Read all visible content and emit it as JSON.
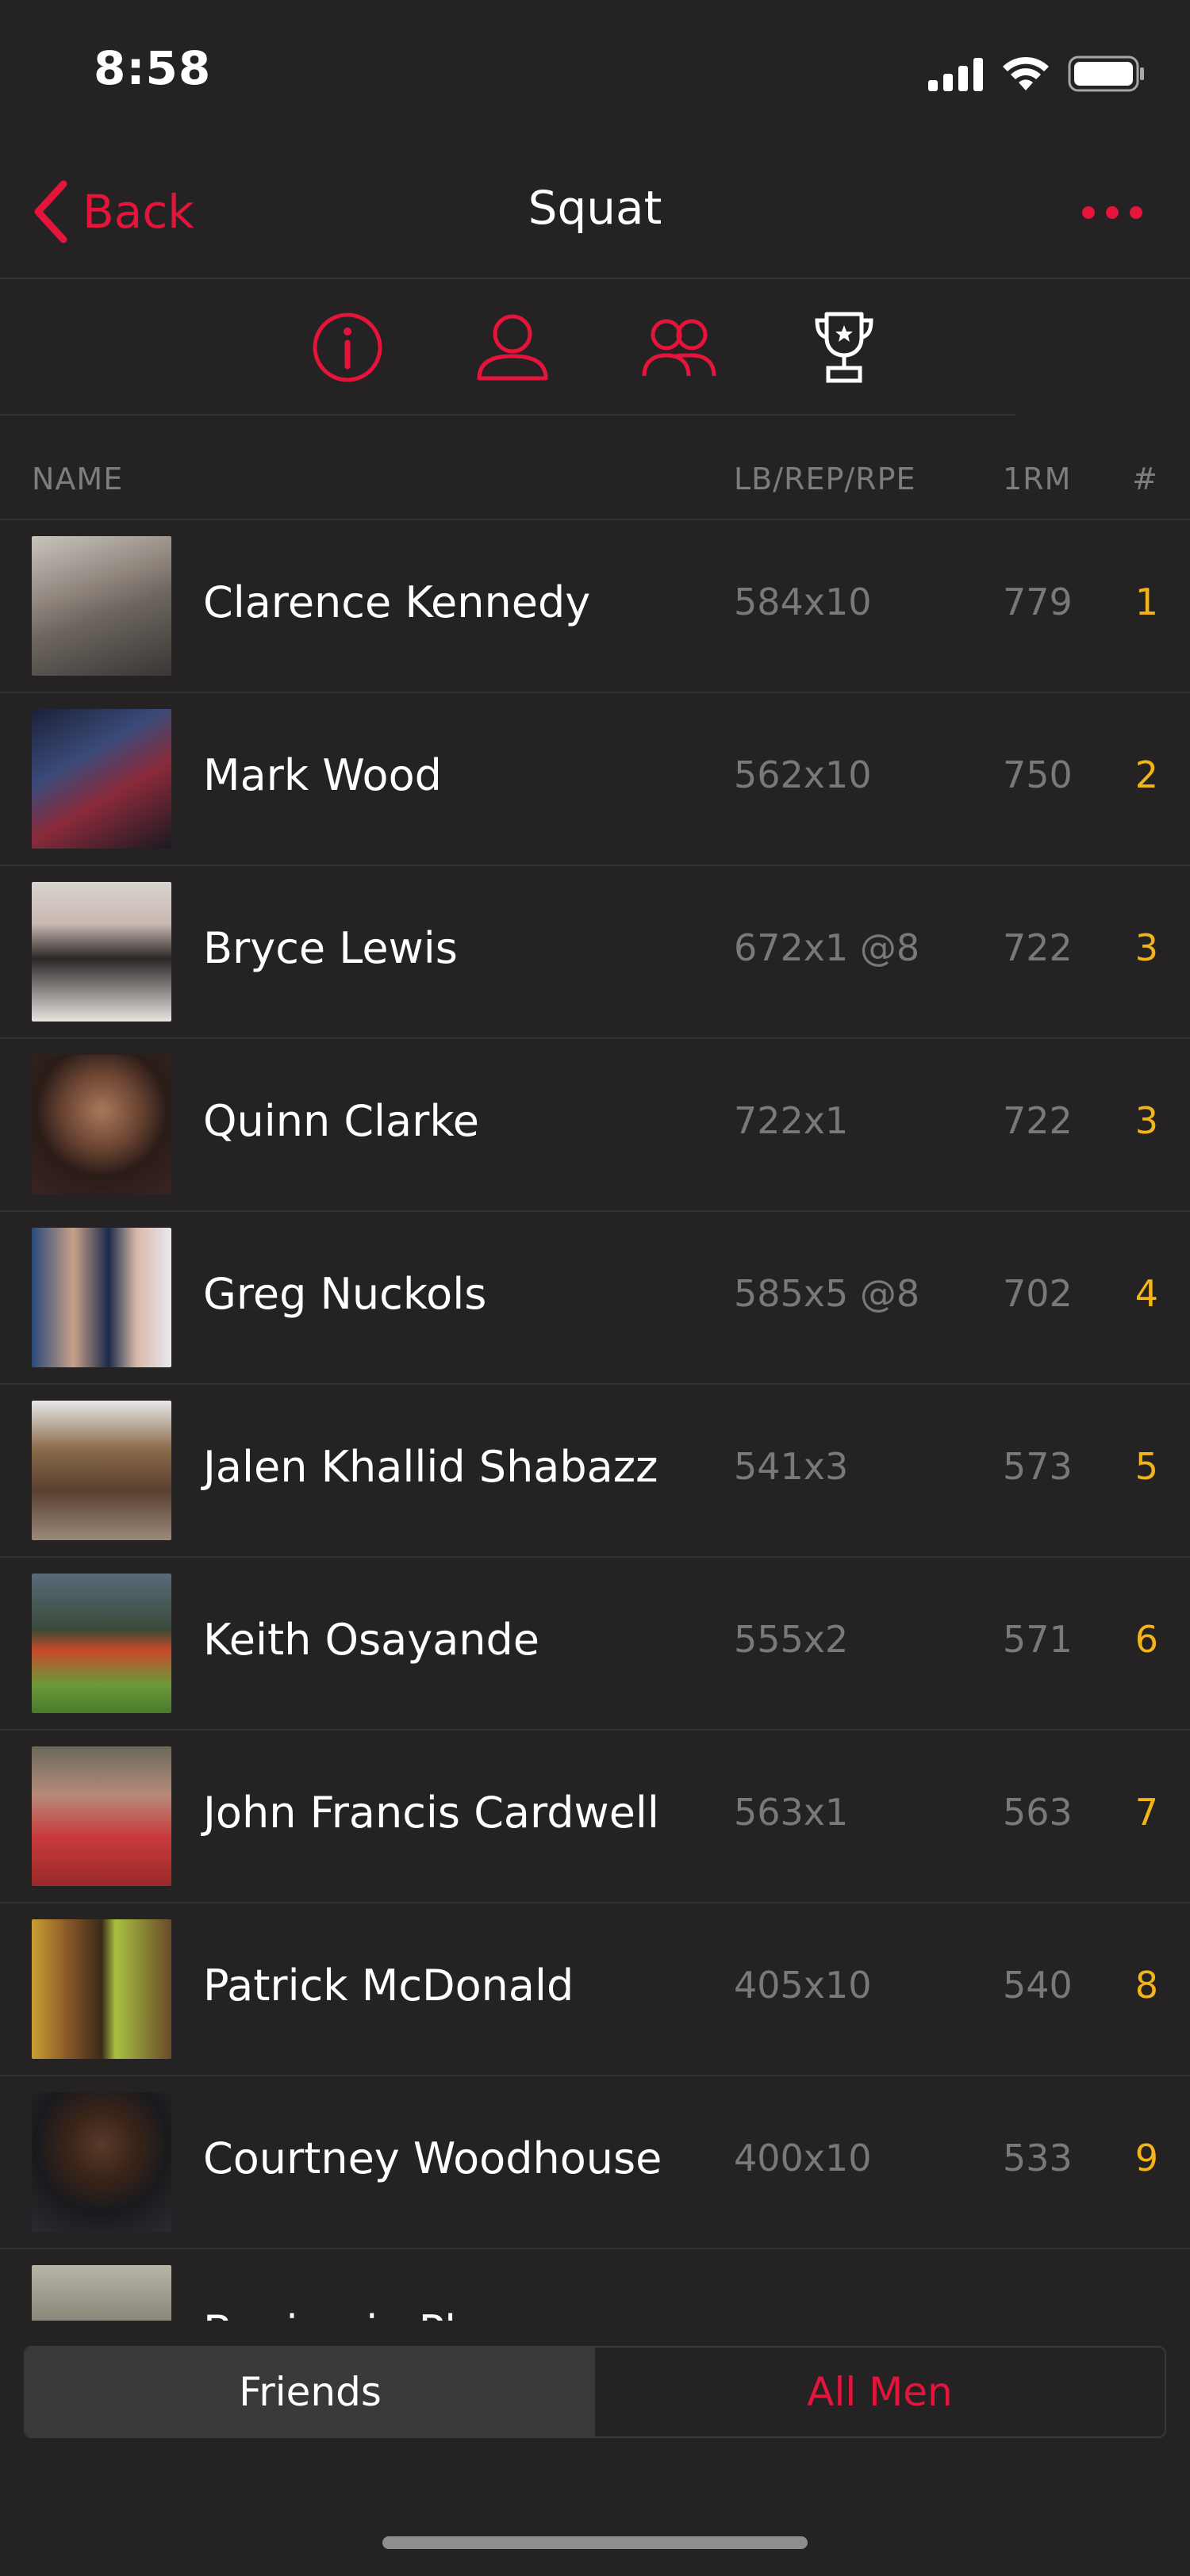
{
  "status_bar": {
    "time": "8:58"
  },
  "nav": {
    "back_label": "Back",
    "title": "Squat"
  },
  "icon_tabs": [
    {
      "icon": "info-icon",
      "active": false
    },
    {
      "icon": "person-icon",
      "active": false
    },
    {
      "icon": "group-icon",
      "active": false
    },
    {
      "icon": "trophy-icon",
      "active": true
    }
  ],
  "columns": {
    "name": "NAME",
    "lift": "LB/REP/RPE",
    "one_rm": "1RM",
    "rank": "#"
  },
  "rows": [
    {
      "name": "Clarence Kennedy",
      "lift": "584x10",
      "one_rm": "779",
      "rank": "1"
    },
    {
      "name": "Mark Wood",
      "lift": "562x10",
      "one_rm": "750",
      "rank": "2"
    },
    {
      "name": "Bryce Lewis",
      "lift": "672x1 @8",
      "one_rm": "722",
      "rank": "3"
    },
    {
      "name": "Quinn Clarke",
      "lift": "722x1",
      "one_rm": "722",
      "rank": "3"
    },
    {
      "name": "Greg Nuckols",
      "lift": "585x5 @8",
      "one_rm": "702",
      "rank": "4"
    },
    {
      "name": "Jalen Khallid Shabazz",
      "lift": "541x3",
      "one_rm": "573",
      "rank": "5"
    },
    {
      "name": "Keith Osayande",
      "lift": "555x2",
      "one_rm": "571",
      "rank": "6"
    },
    {
      "name": "John Francis Cardwell",
      "lift": "563x1",
      "one_rm": "563",
      "rank": "7"
    },
    {
      "name": "Patrick McDonald",
      "lift": "405x10",
      "one_rm": "540",
      "rank": "8"
    },
    {
      "name": "Courtney Woodhouse",
      "lift": "400x10",
      "one_rm": "533",
      "rank": "9"
    },
    {
      "name": "Benjamin Pl",
      "lift": "",
      "one_rm": "",
      "rank": ""
    }
  ],
  "segments": {
    "friends": "Friends",
    "all_men": "All Men",
    "selected": "Friends"
  },
  "colors": {
    "background": "#242223",
    "accent": "#e4143b",
    "rank": "#f2b418",
    "muted_text": "#7a7879"
  }
}
